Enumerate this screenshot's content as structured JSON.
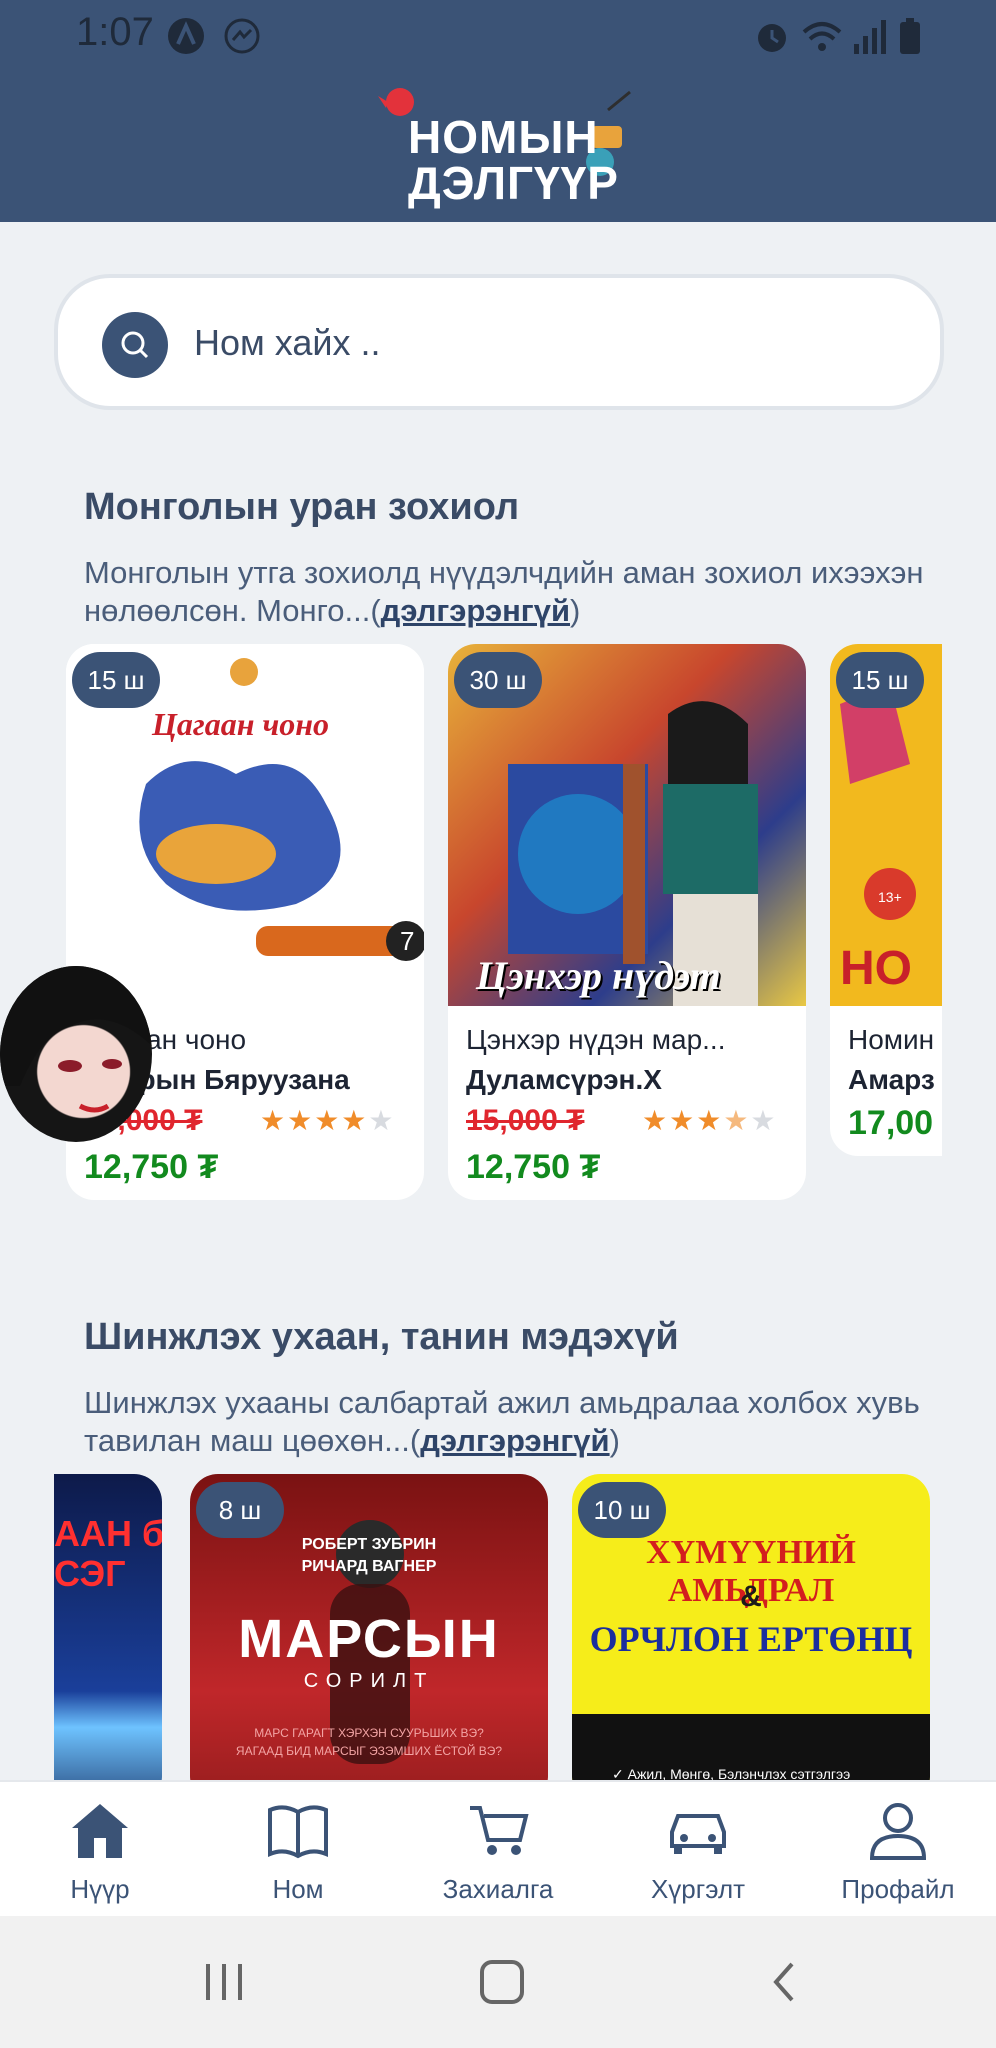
{
  "status_bar": {
    "time": "1:07"
  },
  "header": {
    "logo_line1": "НОМЫН",
    "logo_line2": "ДЭЛГҮҮР"
  },
  "search": {
    "placeholder": "Ном хайх .."
  },
  "sections": [
    {
      "title": "Монголын уран зохиол",
      "description": "Монголын утга зохиолд нүүдэлчдийн аман зохиол ихээхэн нөлөөлсөн. Монго...(",
      "more_link": "дэлгэрэнгүй",
      "close": ")",
      "books": [
        {
          "count": "15 ш",
          "title": "Цагаан чоно",
          "author": "Осорын Бяруузана",
          "old_price": "15,000 ₮",
          "price": "12,750 ₮",
          "rating": 4,
          "cover_text": "Цагаан чоно"
        },
        {
          "count": "30 ш",
          "title": "Цэнхэр нүдэн мар...",
          "author": "Дуламсүрэн.Х",
          "old_price": "15,000 ₮",
          "price": "12,750 ₮",
          "rating": 3.5,
          "cover_text": "Цэнхэр нүдэт"
        },
        {
          "count": "15 ш",
          "title": "Номин",
          "author": "Амарз",
          "price": "17,00"
        }
      ]
    },
    {
      "title": "Шинжлэх ухаан, танин мэдэхүй",
      "description": "Шинжлэх ухааны салбартай ажил амьдралаа холбох хувь тавилан маш цөөхөн...(",
      "more_link": "дэлгэрэнгүй",
      "close": ")",
      "books": [
        {
          "cover_text": "ААН ба\nСЭГ"
        },
        {
          "count": "8 ш",
          "cover_authors": "РОБЕРТ ЗУБРИН\nРИЧАРД ВАГНЕР",
          "cover_text": "МАРСЫН",
          "cover_sub": "СОРИЛТ",
          "cover_q": "МАРС ГАРАГТ ХЭРХЭН СУУРЬШИХ ВЭ?\nЯАГААД БИД МАРСЫГ ЭЗЭМШИХ ЁСТОЙ ВЭ?"
        },
        {
          "count": "10 ш",
          "cover_text": "ХҮМҮҮНИЙ АМЬДРАЛ",
          "cover_amp": "&",
          "cover_text2": "ОРЧЛОН ЕРТӨНЦ",
          "cover_footer": "✓ Ажил, Мөнгө, Бэлэнчлэх сэтгэлгээ"
        }
      ]
    }
  ],
  "bottom_nav": [
    {
      "label": "Нүүр",
      "icon": "home-icon"
    },
    {
      "label": "Ном",
      "icon": "book-icon"
    },
    {
      "label": "Захиалга",
      "icon": "cart-icon"
    },
    {
      "label": "Хүргэлт",
      "icon": "car-icon"
    },
    {
      "label": "Профайл",
      "icon": "user-icon"
    }
  ],
  "colors": {
    "primary": "#3b5376",
    "price_new": "#128a1e",
    "price_old": "#e0262e",
    "star": "#f08c2a",
    "background": "#eef1f4"
  }
}
